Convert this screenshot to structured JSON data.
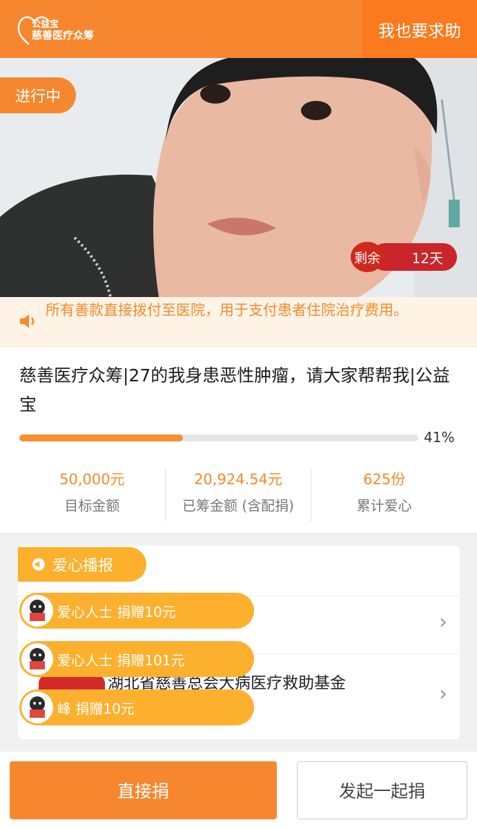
{
  "header": {
    "logo_line1": "公益宝",
    "logo_line2": "慈善医疗众筹",
    "help_button": "我也要求助"
  },
  "hero": {
    "status_badge": "进行中",
    "remaining_label": "剩余",
    "remaining_value": "12天"
  },
  "notice": {
    "text": "所有善款直接拨付至医院，用于支付患者住院治疗费用。"
  },
  "campaign": {
    "title": "慈善医疗众筹|27的我身患恶性肿瘤，请大家帮帮我|公益宝",
    "progress_fraction": 0.41,
    "progress_text": "41%",
    "stats": [
      {
        "value": "50,000元",
        "label": "目标金额"
      },
      {
        "value": "20,924.54元",
        "label": "已筹金额 (含配捐)"
      },
      {
        "value": "625份",
        "label": "累计爱心"
      }
    ]
  },
  "broadcast": {
    "tag": "爱心播报",
    "rows": [
      {
        "text": ""
      },
      {
        "text": "湖北省慈善总会大病医疗救助基金"
      }
    ],
    "donors": [
      {
        "text": "爱心人士 捐赠10元"
      },
      {
        "text": "爱心人士 捐赠101元"
      },
      {
        "text": "峰 捐赠10元"
      }
    ]
  },
  "actions": {
    "donate": "直接捐",
    "together": "发起一起捐"
  },
  "colors": {
    "brand_orange": "#f7872e",
    "donor_yellow": "#fdb02e",
    "remaining_red": "#c9252a"
  }
}
